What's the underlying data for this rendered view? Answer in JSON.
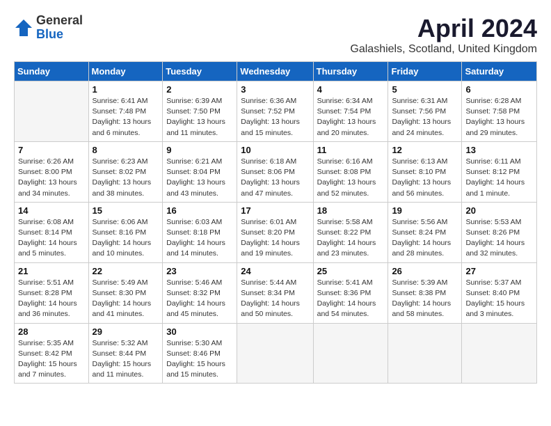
{
  "logo": {
    "general": "General",
    "blue": "Blue"
  },
  "title": "April 2024",
  "location": "Galashiels, Scotland, United Kingdom",
  "days_of_week": [
    "Sunday",
    "Monday",
    "Tuesday",
    "Wednesday",
    "Thursday",
    "Friday",
    "Saturday"
  ],
  "weeks": [
    [
      {
        "date": "",
        "info": ""
      },
      {
        "date": "1",
        "info": "Sunrise: 6:41 AM\nSunset: 7:48 PM\nDaylight: 13 hours\nand 6 minutes."
      },
      {
        "date": "2",
        "info": "Sunrise: 6:39 AM\nSunset: 7:50 PM\nDaylight: 13 hours\nand 11 minutes."
      },
      {
        "date": "3",
        "info": "Sunrise: 6:36 AM\nSunset: 7:52 PM\nDaylight: 13 hours\nand 15 minutes."
      },
      {
        "date": "4",
        "info": "Sunrise: 6:34 AM\nSunset: 7:54 PM\nDaylight: 13 hours\nand 20 minutes."
      },
      {
        "date": "5",
        "info": "Sunrise: 6:31 AM\nSunset: 7:56 PM\nDaylight: 13 hours\nand 24 minutes."
      },
      {
        "date": "6",
        "info": "Sunrise: 6:28 AM\nSunset: 7:58 PM\nDaylight: 13 hours\nand 29 minutes."
      }
    ],
    [
      {
        "date": "7",
        "info": "Sunrise: 6:26 AM\nSunset: 8:00 PM\nDaylight: 13 hours\nand 34 minutes."
      },
      {
        "date": "8",
        "info": "Sunrise: 6:23 AM\nSunset: 8:02 PM\nDaylight: 13 hours\nand 38 minutes."
      },
      {
        "date": "9",
        "info": "Sunrise: 6:21 AM\nSunset: 8:04 PM\nDaylight: 13 hours\nand 43 minutes."
      },
      {
        "date": "10",
        "info": "Sunrise: 6:18 AM\nSunset: 8:06 PM\nDaylight: 13 hours\nand 47 minutes."
      },
      {
        "date": "11",
        "info": "Sunrise: 6:16 AM\nSunset: 8:08 PM\nDaylight: 13 hours\nand 52 minutes."
      },
      {
        "date": "12",
        "info": "Sunrise: 6:13 AM\nSunset: 8:10 PM\nDaylight: 13 hours\nand 56 minutes."
      },
      {
        "date": "13",
        "info": "Sunrise: 6:11 AM\nSunset: 8:12 PM\nDaylight: 14 hours\nand 1 minute."
      }
    ],
    [
      {
        "date": "14",
        "info": "Sunrise: 6:08 AM\nSunset: 8:14 PM\nDaylight: 14 hours\nand 5 minutes."
      },
      {
        "date": "15",
        "info": "Sunrise: 6:06 AM\nSunset: 8:16 PM\nDaylight: 14 hours\nand 10 minutes."
      },
      {
        "date": "16",
        "info": "Sunrise: 6:03 AM\nSunset: 8:18 PM\nDaylight: 14 hours\nand 14 minutes."
      },
      {
        "date": "17",
        "info": "Sunrise: 6:01 AM\nSunset: 8:20 PM\nDaylight: 14 hours\nand 19 minutes."
      },
      {
        "date": "18",
        "info": "Sunrise: 5:58 AM\nSunset: 8:22 PM\nDaylight: 14 hours\nand 23 minutes."
      },
      {
        "date": "19",
        "info": "Sunrise: 5:56 AM\nSunset: 8:24 PM\nDaylight: 14 hours\nand 28 minutes."
      },
      {
        "date": "20",
        "info": "Sunrise: 5:53 AM\nSunset: 8:26 PM\nDaylight: 14 hours\nand 32 minutes."
      }
    ],
    [
      {
        "date": "21",
        "info": "Sunrise: 5:51 AM\nSunset: 8:28 PM\nDaylight: 14 hours\nand 36 minutes."
      },
      {
        "date": "22",
        "info": "Sunrise: 5:49 AM\nSunset: 8:30 PM\nDaylight: 14 hours\nand 41 minutes."
      },
      {
        "date": "23",
        "info": "Sunrise: 5:46 AM\nSunset: 8:32 PM\nDaylight: 14 hours\nand 45 minutes."
      },
      {
        "date": "24",
        "info": "Sunrise: 5:44 AM\nSunset: 8:34 PM\nDaylight: 14 hours\nand 50 minutes."
      },
      {
        "date": "25",
        "info": "Sunrise: 5:41 AM\nSunset: 8:36 PM\nDaylight: 14 hours\nand 54 minutes."
      },
      {
        "date": "26",
        "info": "Sunrise: 5:39 AM\nSunset: 8:38 PM\nDaylight: 14 hours\nand 58 minutes."
      },
      {
        "date": "27",
        "info": "Sunrise: 5:37 AM\nSunset: 8:40 PM\nDaylight: 15 hours\nand 3 minutes."
      }
    ],
    [
      {
        "date": "28",
        "info": "Sunrise: 5:35 AM\nSunset: 8:42 PM\nDaylight: 15 hours\nand 7 minutes."
      },
      {
        "date": "29",
        "info": "Sunrise: 5:32 AM\nSunset: 8:44 PM\nDaylight: 15 hours\nand 11 minutes."
      },
      {
        "date": "30",
        "info": "Sunrise: 5:30 AM\nSunset: 8:46 PM\nDaylight: 15 hours\nand 15 minutes."
      },
      {
        "date": "",
        "info": ""
      },
      {
        "date": "",
        "info": ""
      },
      {
        "date": "",
        "info": ""
      },
      {
        "date": "",
        "info": ""
      }
    ]
  ]
}
